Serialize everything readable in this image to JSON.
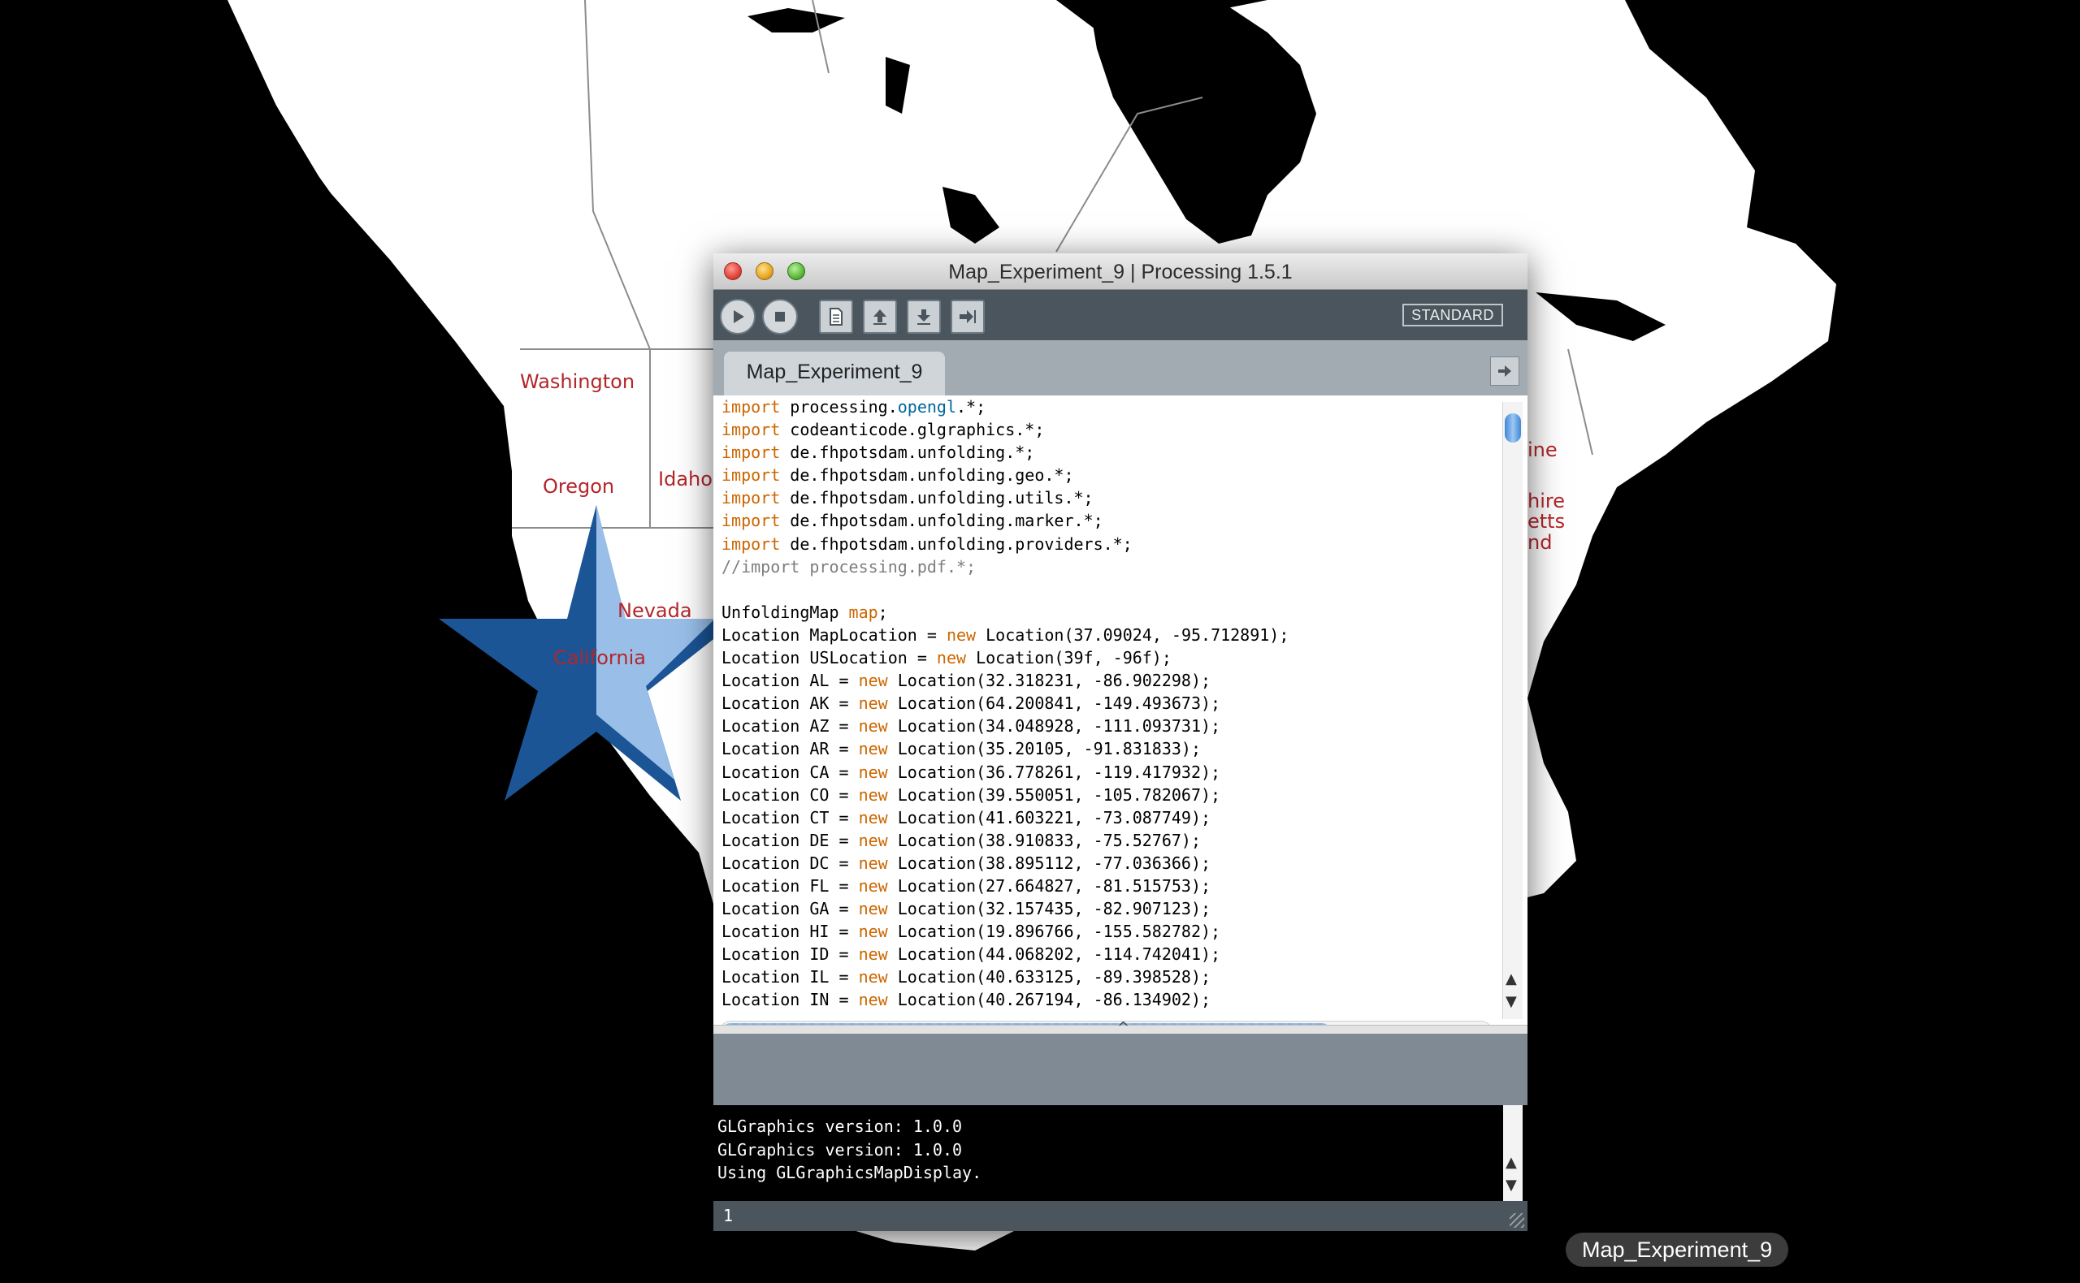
{
  "map": {
    "states": {
      "washington": "Washington",
      "oregon": "Oregon",
      "idaho": "Idaho",
      "nevada": "Nevada",
      "california": "California",
      "partial_1": "ine",
      "partial_2": "hire",
      "partial_3": "etts",
      "partial_4": "nd"
    },
    "colors": {
      "land": "#ffffff",
      "water": "#000000",
      "label": "#b3262a",
      "star_dark": "#1b5596",
      "star_light": "#a7cbf2"
    }
  },
  "window": {
    "title": "Map_Experiment_9 | Processing 1.5.1",
    "toolbar": {
      "run_icon": "play-icon",
      "stop_icon": "stop-icon",
      "new_icon": "new-sketch-icon",
      "open_icon": "open-arrow-up-icon",
      "save_icon": "save-arrow-down-icon",
      "export_icon": "export-arrow-icon",
      "mode_label": "STANDARD"
    },
    "tab": {
      "label": "Map_Experiment_9"
    },
    "code_lines": [
      [
        [
          "kw",
          "import"
        ],
        [
          "t",
          " processing."
        ],
        [
          "fn",
          "opengl"
        ],
        [
          "t",
          ".*;"
        ]
      ],
      [
        [
          "kw",
          "import"
        ],
        [
          "t",
          " codeanticode.glgraphics.*;"
        ]
      ],
      [
        [
          "kw",
          "import"
        ],
        [
          "t",
          " de.fhpotsdam.unfolding.*;"
        ]
      ],
      [
        [
          "kw",
          "import"
        ],
        [
          "t",
          " de.fhpotsdam.unfolding.geo.*;"
        ]
      ],
      [
        [
          "kw",
          "import"
        ],
        [
          "t",
          " de.fhpotsdam.unfolding.utils.*;"
        ]
      ],
      [
        [
          "kw",
          "import"
        ],
        [
          "t",
          " de.fhpotsdam.unfolding.marker.*;"
        ]
      ],
      [
        [
          "kw",
          "import"
        ],
        [
          "t",
          " de.fhpotsdam.unfolding.providers.*;"
        ]
      ],
      [
        [
          "cm",
          "//import processing.pdf.*;"
        ]
      ],
      [
        [
          "t",
          ""
        ]
      ],
      [
        [
          "t",
          "UnfoldingMap "
        ],
        [
          "kw",
          "map"
        ],
        [
          "t",
          ";"
        ]
      ],
      [
        [
          "t",
          "Location MapLocation = "
        ],
        [
          "kw",
          "new"
        ],
        [
          "t",
          " Location(37.09024, -95.712891);"
        ]
      ],
      [
        [
          "t",
          "Location USLocation = "
        ],
        [
          "kw",
          "new"
        ],
        [
          "t",
          " Location(39f, -96f);"
        ]
      ],
      [
        [
          "t",
          "Location AL = "
        ],
        [
          "kw",
          "new"
        ],
        [
          "t",
          " Location(32.318231, -86.902298);"
        ]
      ],
      [
        [
          "t",
          "Location AK = "
        ],
        [
          "kw",
          "new"
        ],
        [
          "t",
          " Location(64.200841, -149.493673);"
        ]
      ],
      [
        [
          "t",
          "Location AZ = "
        ],
        [
          "kw",
          "new"
        ],
        [
          "t",
          " Location(34.048928, -111.093731);"
        ]
      ],
      [
        [
          "t",
          "Location AR = "
        ],
        [
          "kw",
          "new"
        ],
        [
          "t",
          " Location(35.20105, -91.831833);"
        ]
      ],
      [
        [
          "t",
          "Location CA = "
        ],
        [
          "kw",
          "new"
        ],
        [
          "t",
          " Location(36.778261, -119.417932);"
        ]
      ],
      [
        [
          "t",
          "Location CO = "
        ],
        [
          "kw",
          "new"
        ],
        [
          "t",
          " Location(39.550051, -105.782067);"
        ]
      ],
      [
        [
          "t",
          "Location CT = "
        ],
        [
          "kw",
          "new"
        ],
        [
          "t",
          " Location(41.603221, -73.087749);"
        ]
      ],
      [
        [
          "t",
          "Location DE = "
        ],
        [
          "kw",
          "new"
        ],
        [
          "t",
          " Location(38.910833, -75.52767);"
        ]
      ],
      [
        [
          "t",
          "Location DC = "
        ],
        [
          "kw",
          "new"
        ],
        [
          "t",
          " Location(38.895112, -77.036366);"
        ]
      ],
      [
        [
          "t",
          "Location FL = "
        ],
        [
          "kw",
          "new"
        ],
        [
          "t",
          " Location(27.664827, -81.515753);"
        ]
      ],
      [
        [
          "t",
          "Location GA = "
        ],
        [
          "kw",
          "new"
        ],
        [
          "t",
          " Location(32.157435, -82.907123);"
        ]
      ],
      [
        [
          "t",
          "Location HI = "
        ],
        [
          "kw",
          "new"
        ],
        [
          "t",
          " Location(19.896766, -155.582782);"
        ]
      ],
      [
        [
          "t",
          "Location ID = "
        ],
        [
          "kw",
          "new"
        ],
        [
          "t",
          " Location(44.068202, -114.742041);"
        ]
      ],
      [
        [
          "t",
          "Location IL = "
        ],
        [
          "kw",
          "new"
        ],
        [
          "t",
          " Location(40.633125, -89.398528);"
        ]
      ],
      [
        [
          "t",
          "Location IN = "
        ],
        [
          "kw",
          "new"
        ],
        [
          "t",
          " Location(40.267194, -86.134902);"
        ]
      ]
    ],
    "console_lines": [
      "GLGraphics version: 1.0.0",
      "GLGraphics version: 1.0.0",
      "Using GLGraphicsMapDisplay."
    ],
    "status_line": "1"
  },
  "dock_label": "Map_Experiment_9"
}
